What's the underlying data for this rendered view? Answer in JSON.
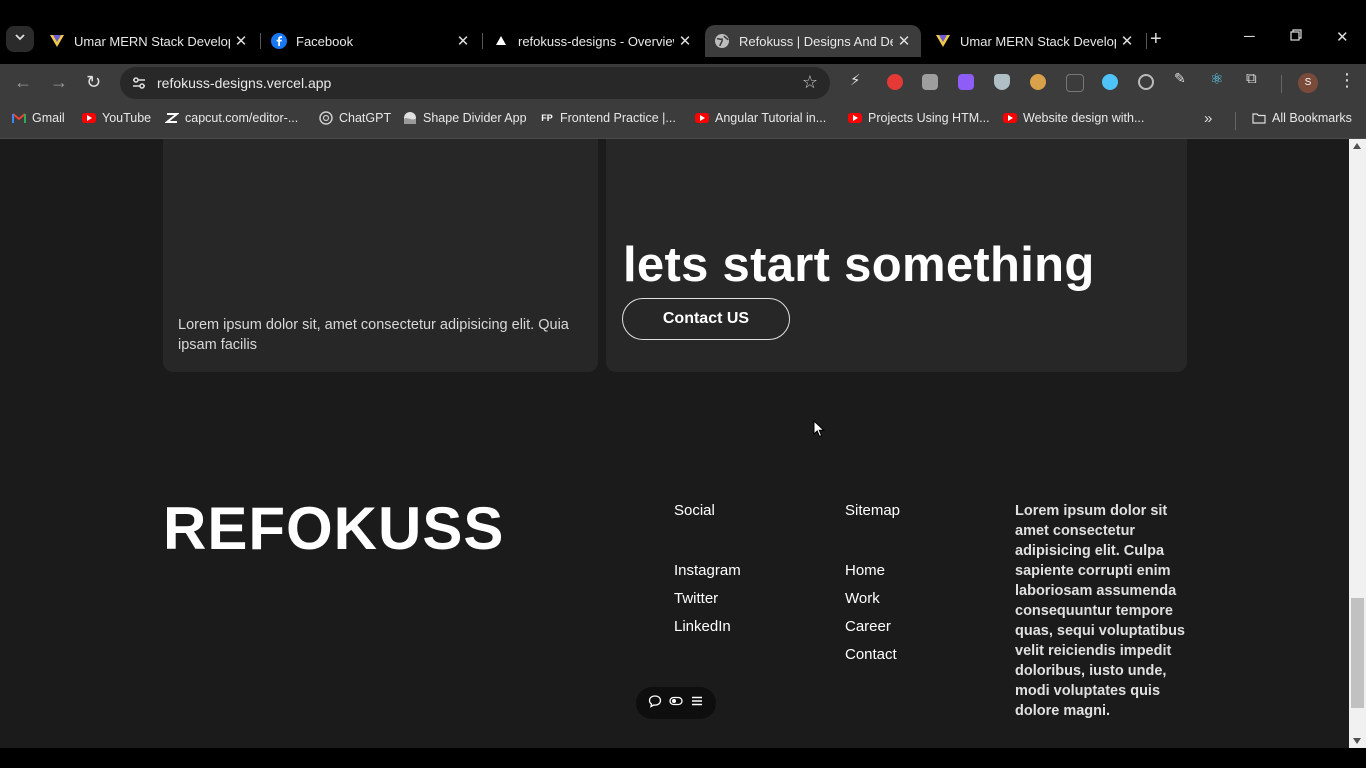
{
  "browser": {
    "tabs": [
      {
        "title": "Umar MERN Stack Develope",
        "icon": "vercel-v-icon"
      },
      {
        "title": "Facebook",
        "icon": "facebook-icon"
      },
      {
        "title": "refokuss-designs - Overview",
        "icon": "vercel-triangle-icon"
      },
      {
        "title": "Refokuss | Designs And Dev",
        "icon": "globe-icon",
        "active": true
      },
      {
        "title": "Umar MERN Stack Develope",
        "icon": "vercel-v-icon"
      }
    ],
    "url": "refokuss-designs.vercel.app",
    "bookmarks": [
      {
        "label": "Gmail",
        "icon": "gmail-icon"
      },
      {
        "label": "YouTube",
        "icon": "youtube-icon"
      },
      {
        "label": "capcut.com/editor-...",
        "icon": "capcut-icon"
      },
      {
        "label": "ChatGPT",
        "icon": "chatgpt-icon"
      },
      {
        "label": "Shape Divider App",
        "icon": "shape-divider-icon"
      },
      {
        "label": "Frontend Practice |...",
        "icon": "fp-icon",
        "badge": "FP"
      },
      {
        "label": "Angular Tutorial in...",
        "icon": "youtube-icon"
      },
      {
        "label": "Projects Using HTM...",
        "icon": "youtube-icon"
      },
      {
        "label": "Website design with...",
        "icon": "youtube-icon"
      }
    ],
    "all_bookmarks": "All Bookmarks",
    "profile_initial": "S"
  },
  "page": {
    "card_left_text": "Lorem ipsum dolor sit, amet consectetur adipisicing elit. Quia ipsam facilis",
    "cta_heading": "lets start something",
    "contact_button": "Contact US",
    "brand": "REFOKUSS",
    "social": {
      "heading": "Social",
      "links": [
        "Instagram",
        "Twitter",
        "LinkedIn"
      ]
    },
    "sitemap": {
      "heading": "Sitemap",
      "links": [
        "Home",
        "Work",
        "Career",
        "Contact"
      ]
    },
    "footer_text": "Lorem ipsum dolor sit amet consectetur adipisicing elit. Culpa sapiente corrupti enim laboriosam assumenda consequuntur tempore quas, sequi voluptatibus velit reiciendis impedit doloribus, iusto unde, modi voluptates quis dolore magni."
  },
  "colors": {
    "page_bg": "#1b1b1b",
    "card_bg": "#272727",
    "chrome_bg": "#3c3c3c",
    "youtube_red": "#ff0000"
  }
}
